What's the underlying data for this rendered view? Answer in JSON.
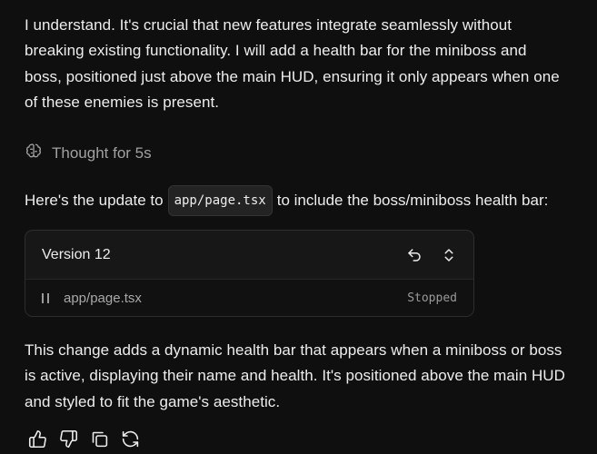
{
  "message": {
    "paragraph1": [
      "I understand. It's crucial that new features integrate seamlessly without",
      "breaking existing functionality. I will add a health bar for the miniboss and",
      "boss, positioned just above the main HUD, ensuring it only appears when one",
      "of these enemies is present."
    ],
    "thought": {
      "icon": "brain-icon",
      "label": "Thought for 5s"
    },
    "intro_before": "Here's the update to",
    "intro_code": "app/page.tsx",
    "intro_after": "to include the boss/miniboss health bar:",
    "version_card": {
      "title": "Version 12",
      "undo_icon": "undo-icon",
      "expand_icon": "chevron-updown-icon",
      "file": "app/page.tsx",
      "status": "Stopped"
    },
    "paragraph2": [
      "This change adds a dynamic health bar that appears when a miniboss or boss",
      "is active, displaying their name and health. It's positioned above the main HUD",
      "and styled to fit the game's aesthetic."
    ]
  },
  "actions": [
    {
      "name": "thumbs-up-icon"
    },
    {
      "name": "thumbs-down-icon"
    },
    {
      "name": "copy-icon"
    },
    {
      "name": "refresh-icon"
    }
  ],
  "colors": {
    "background": "#0f0f0f",
    "text": "#ededed",
    "muted": "#a1a1a1"
  }
}
